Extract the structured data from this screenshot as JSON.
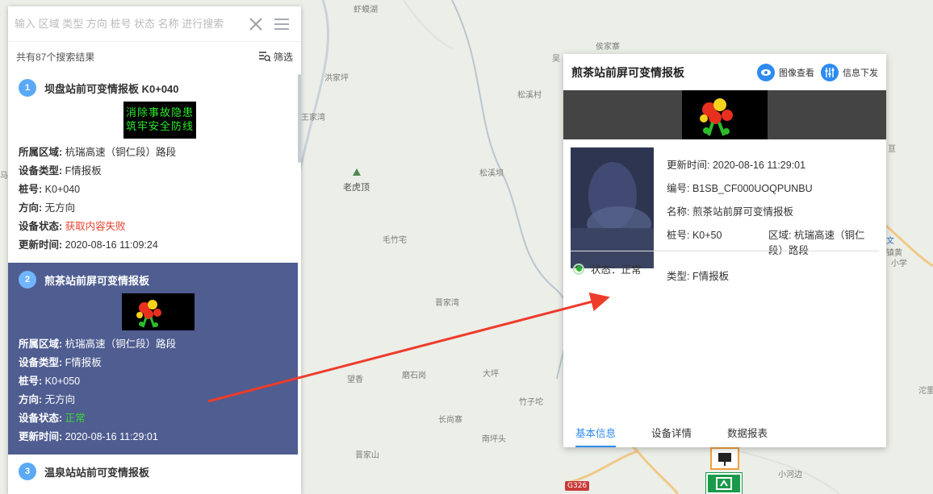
{
  "search": {
    "placeholder": "输入 区域 类型 方向 桩号 状态 名称 进行搜索",
    "result_count": "共有87个搜索结果",
    "filter_label": "筛选"
  },
  "results": [
    {
      "index": "1",
      "title": "坝盘站前可变情报板 K0+040",
      "board_lines": [
        "消除事故隐患",
        "筑牢安全防线"
      ],
      "region_label": "所属区域:",
      "region": "杭瑞高速（铜仁段）路段",
      "type_label": "设备类型:",
      "type": "F情报板",
      "stake_label": "桩号:",
      "stake": "K0+040",
      "direction_label": "方向:",
      "direction": "无方向",
      "status_label": "设备状态:",
      "status": "获取内容失败",
      "time_label": "更新时间:",
      "time": "2020-08-16 11:09:24"
    },
    {
      "index": "2",
      "title": "煎茶站前屏可变情报板",
      "region_label": "所属区域:",
      "region": "杭瑞高速（铜仁段）路段",
      "type_label": "设备类型:",
      "type": "F情报板",
      "stake_label": "桩号:",
      "stake": "K0+050",
      "direction_label": "方向:",
      "direction": "无方向",
      "status_label": "设备状态:",
      "status": "正常",
      "time_label": "更新时间:",
      "time": "2020-08-16 11:29:01"
    },
    {
      "index": "3",
      "title": "温泉站站前可变情报板"
    }
  ],
  "popup": {
    "title": "煎茶站前屏可变情报板",
    "image_view_label": "图像查看",
    "info_send_label": "信息下发",
    "update_time": "更新时间: 2020-08-16 11:29:01",
    "code": "编号: B1SB_CF000UOQPUNBU",
    "name": "名称: 煎茶站前屏可变情报板",
    "stake": "桩号: K0+50",
    "region": "区域: 杭瑞高速（铜仁段）路段",
    "type": "类型: F情报板",
    "status": "状态：正常",
    "tabs": [
      "基本信息",
      "设备详情",
      "数据报表"
    ]
  },
  "map_labels": [
    "虾蟆湖",
    "侯家寨",
    "吴",
    "洪家坪",
    "王家湾",
    "松溪村",
    "松溪坝",
    "老虎顶",
    "毛竹宅",
    "晋家湾",
    "望香",
    "磨石岗",
    "大坪",
    "竹子坨",
    "长尚寨",
    "南坪头",
    "晋家山",
    "小河边",
    "G326",
    "马",
    "文",
    "镇黄",
    "小学",
    "沱里",
    "亘"
  ],
  "colors": {
    "selected_bg": "#4f5d91",
    "accent": "#2e8bf0",
    "status_fail": "#e8412f",
    "status_ok": "#38d538",
    "arrow": "#ee3b2b"
  }
}
